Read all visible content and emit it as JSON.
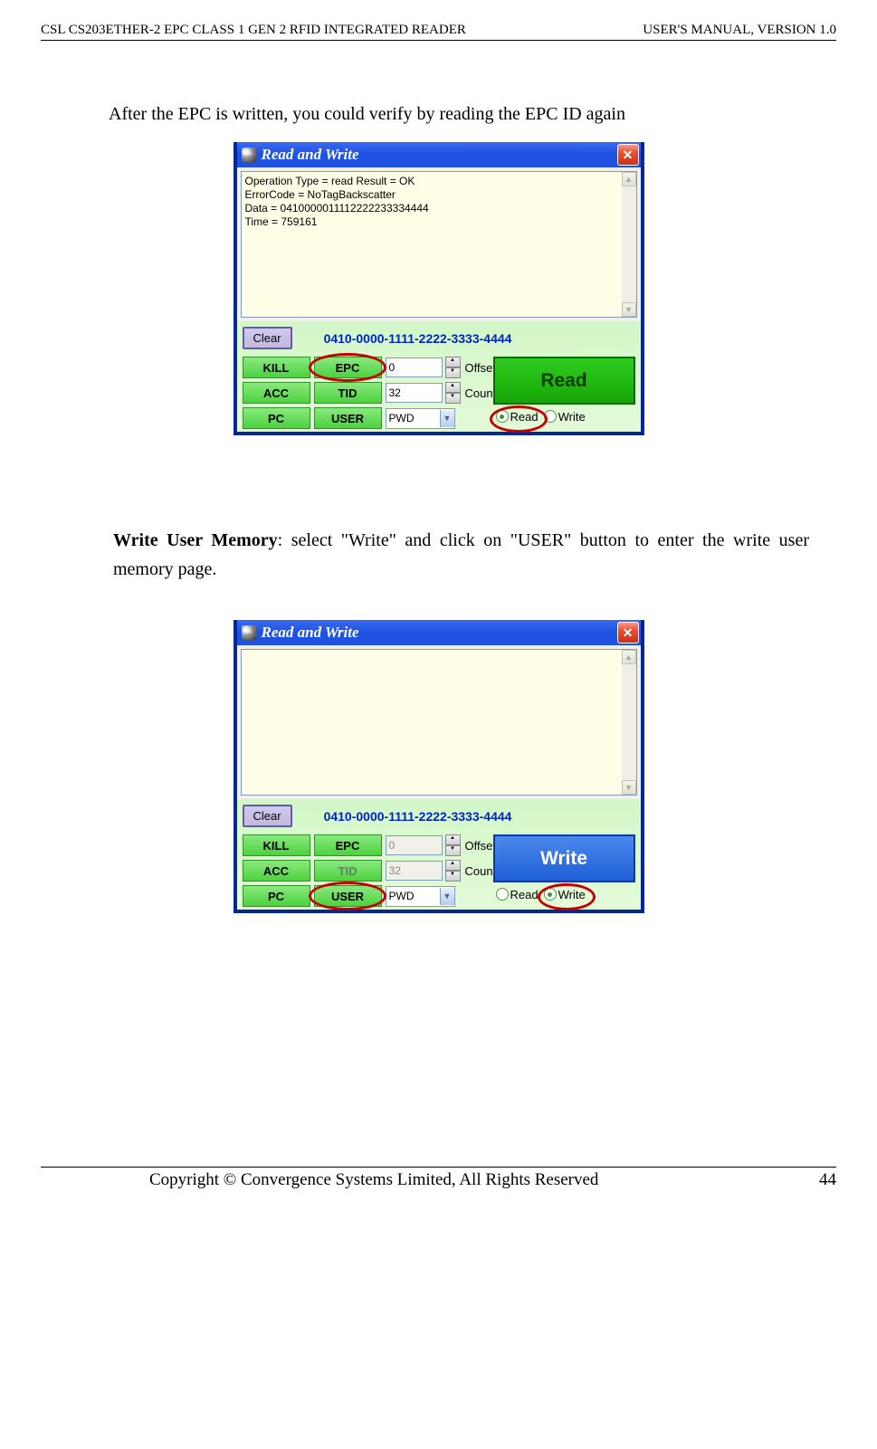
{
  "header": {
    "left": "CSL CS203ETHER-2 EPC CLASS 1 GEN 2 RFID INTEGRATED READER",
    "right": "USER'S  MANUAL,  VERSION  1.0"
  },
  "text1": "After the EPC is written, you could verify by reading the EPC ID again",
  "section2_prefix_bold": "Write User Memory",
  "section2_rest": ": select \"Write\" and click on \"USER\" button to enter the write user memory page.",
  "window": {
    "title": "Read and Write",
    "result_lines": [
      "Operation Type = read   Result = OK",
      "ErrorCode = NoTagBackscatter",
      "Data = 0410000011112222233334444",
      "Time = 759161"
    ],
    "clear": "Clear",
    "epc_id": "0410-0000-1111-2222-3333-4444",
    "buttons": {
      "kill": "KILL",
      "epc": "EPC",
      "acc": "ACC",
      "tid": "TID",
      "pc": "PC",
      "user": "USER"
    },
    "offset": {
      "value": "0",
      "label": "Offset"
    },
    "count": {
      "value": "32",
      "label": "Count"
    },
    "dropdown": "PWD",
    "read_label": "Read",
    "write_label": "Write",
    "big_read": "Read",
    "big_write": "Write"
  },
  "footer": {
    "left": "Copyright © Convergence Systems Limited, All Rights Reserved",
    "right": "44"
  }
}
